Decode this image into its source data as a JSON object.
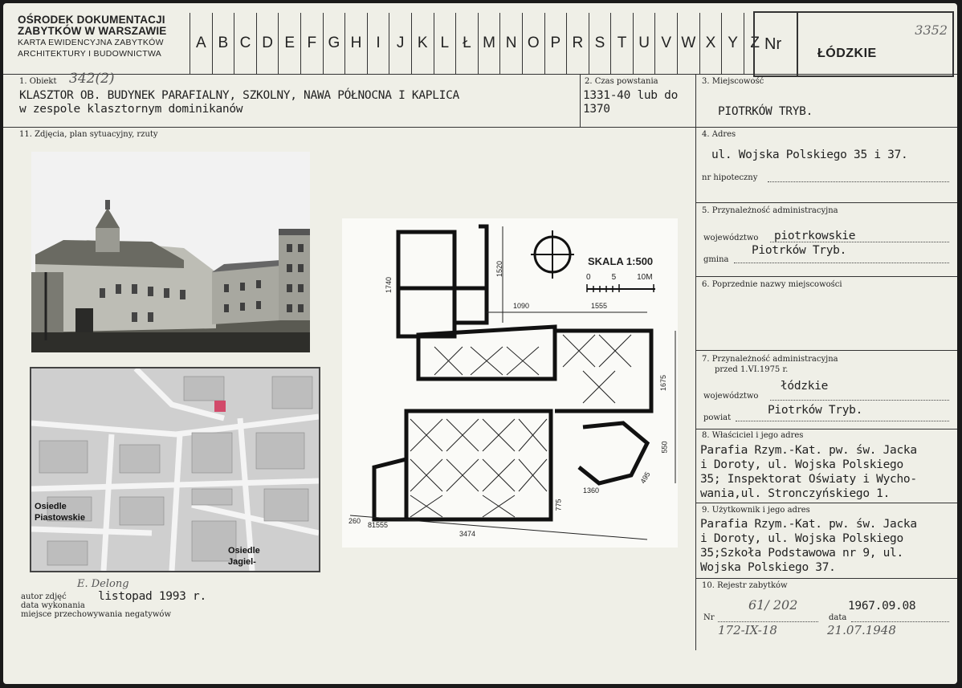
{
  "header": {
    "org_line1": "OŚRODEK DOKUMENTACJI",
    "org_line2": "ZABYTKÓW W WARSZAWIE",
    "org_line3": "KARTA EWIDENCYJNA ZABYTKÓW",
    "org_line4": "ARCHITEKTURY I BUDOWNICTWA",
    "letters": [
      "A",
      "B",
      "C",
      "D",
      "E",
      "F",
      "G",
      "H",
      "I",
      "J",
      "K",
      "L",
      "Ł",
      "M",
      "N",
      "O",
      "P",
      "R",
      "S",
      "T",
      "U",
      "V",
      "W",
      "X",
      "Y",
      "Z"
    ],
    "nr_label": "Nr",
    "voivodeship": "ŁÓDZKIE",
    "handwritten_number": "3352"
  },
  "fields": {
    "object": {
      "label": "1. Obiekt",
      "handwritten": "342(2)",
      "line1": "KLASZTOR OB. BUDYNEK PARAFIALNY, SZKOLNY, NAWA PÓŁNOCNA I KAPLICA",
      "line2": "w zespole klasztornym dominikanów"
    },
    "period": {
      "label": "2. Czas powstania",
      "line1": "1331-40 lub do",
      "line2": "1370"
    },
    "locality": {
      "label": "3. Miejscowość",
      "value": "PIOTRKÓW TRYB."
    },
    "photos": {
      "label": "11. Zdjęcia, plan sytuacyjny, rzuty"
    },
    "address": {
      "label": "4. Adres",
      "value": "ul. Wojska Polskiego 35 i 37.",
      "mortgage_label": "nr hipoteczny"
    },
    "admin": {
      "label": "5. Przynależność administracyjna",
      "voivodeship_label": "województwo",
      "voivodeship": "piotrkowskie",
      "commune": "Piotrków Tryb.",
      "commune_label": "gmina"
    },
    "previous_names": {
      "label": "6. Poprzednie nazwy miejscowości"
    },
    "admin_before": {
      "label": "7. Przynależność administracyjna",
      "sublabel": "przed 1.VI.1975 r.",
      "voivodeship": "łódzkie",
      "voivodeship_label": "województwo",
      "district": "Piotrków Tryb.",
      "district_label": "powiat"
    },
    "owner": {
      "label": "8. Właściciel i jego adres",
      "line1": "Parafia Rzym.-Kat. pw. św. Jacka",
      "line2": "i Doroty, ul. Wojska Polskiego",
      "line3": "35; Inspektorat Oświaty i Wycho-",
      "line4": "wania,ul. Stronczyńskiego 1."
    },
    "user": {
      "label": "9. Użytkownik i jego adres",
      "line1": "Parafia Rzym.-Kat. pw. św. Jacka",
      "line2": "i Doroty, ul. Wojska Polskiego",
      "line3": "35;Szkoła Podstawowa nr 9, ul.",
      "line4": "Wojska Polskiego 37."
    },
    "registry": {
      "label": "10. Rejestr zabytków",
      "number": "61/ 202",
      "date": "1967.09.08",
      "nr_label": "Nr",
      "date_label": "data",
      "old_number": "172-IX-18",
      "old_date": "21.07.1948"
    }
  },
  "map": {
    "label1_line1": "Osiedle",
    "label1_line2": "Piastowskie",
    "label2_line1": "Osiedle",
    "label2_line2": "Jagiel-"
  },
  "plan": {
    "scale": "SKALA 1:500",
    "tick0": "0",
    "tick5": "5",
    "tick10": "10M",
    "dims": {
      "d1090": "1090",
      "d1555": "1555",
      "d1740": "1740",
      "d1520": "1520",
      "d1675": "1675",
      "d550": "550",
      "d495": "495",
      "d1360": "1360",
      "d775": "775",
      "d260": "260",
      "d81555": "81555",
      "d3474": "3474"
    }
  },
  "credits": {
    "author_label": "autor zdjęć",
    "author_value": "E. Delong",
    "date_label": "data wykonania",
    "date_value": "listopad 1993 r.",
    "negatives_label": "miejsce przechowywania negatywów"
  }
}
